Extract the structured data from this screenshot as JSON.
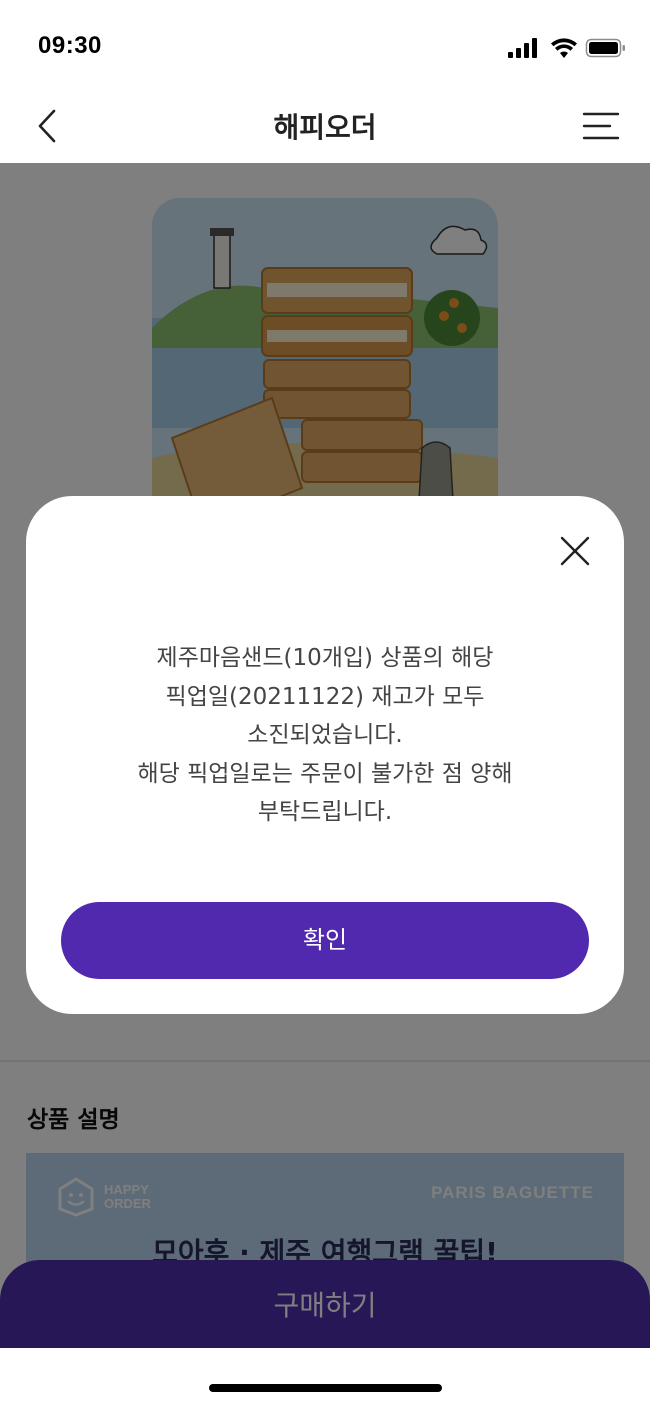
{
  "status_bar": {
    "time": "09:30",
    "icons": [
      "cellular-signal-icon",
      "wifi-icon",
      "battery-icon"
    ]
  },
  "nav": {
    "title": "해피오더",
    "back_icon": "chevron-left-icon",
    "menu_icon": "hamburger-menu-icon"
  },
  "content": {
    "section_title": "상품 설명",
    "banner": {
      "logo_line1": "HAPPY",
      "logo_line2": "ORDER",
      "brand": "PARIS BAGUETTE",
      "headline": "모아후 · 제주 여행그램 꿀팁!"
    },
    "buy_button_label": "구매하기"
  },
  "modal": {
    "close_icon": "close-icon",
    "message_lines": [
      "제주마음샌드(10개입) 상품의 해당",
      "픽업일(20211122) 재고가 모두",
      "소진되었습니다.",
      "해당 픽업일로는 주문이 불가한 점 양해",
      "부탁드립니다."
    ],
    "confirm_label": "확인"
  },
  "colors": {
    "primary_purple": "#5029ae",
    "overlay": "rgba(0,0,0,0.5)",
    "background": "#ffffff"
  }
}
